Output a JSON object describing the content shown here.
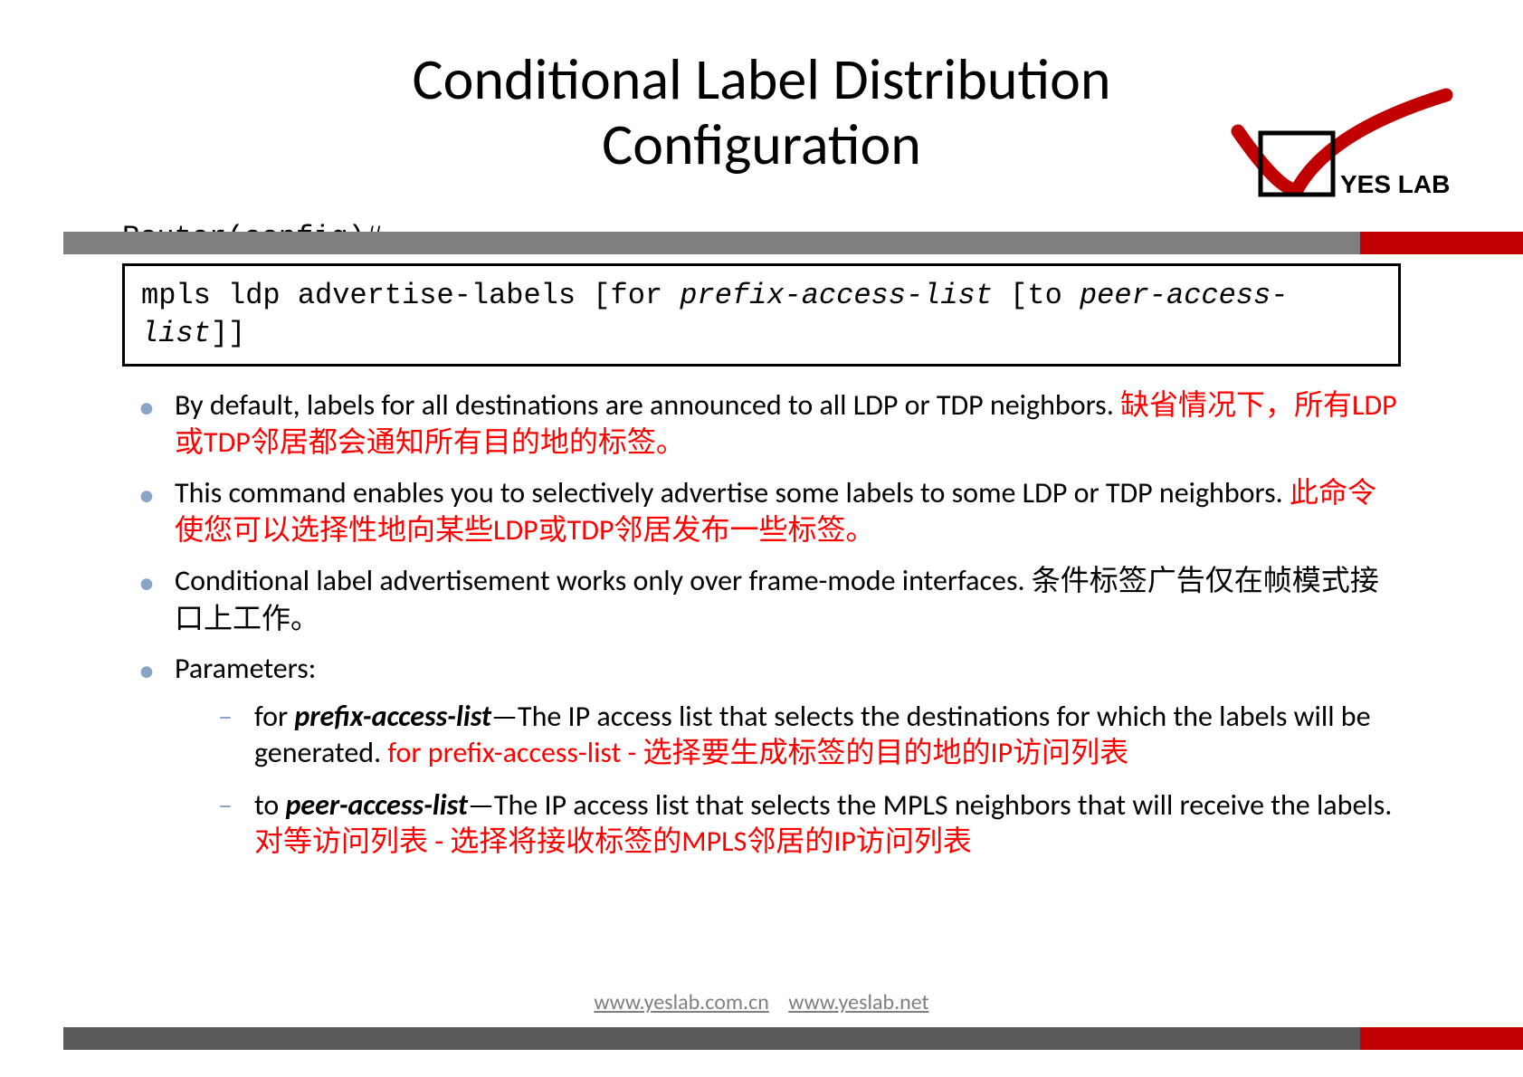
{
  "title": {
    "line1": "Conditional Label Distribution",
    "line2": "Configuration"
  },
  "logo": {
    "text": "YES LAB"
  },
  "prompt": "Router(config)#",
  "command": {
    "prefix": "mpls ldp advertise-labels [for ",
    "arg1": "prefix-access-list",
    "mid": " [to ",
    "arg2": "peer-access-list",
    "suffix": "]]"
  },
  "bullets": {
    "b1_en": "By default, labels for all destinations are announced to all LDP or TDP neighbors. ",
    "b1_zh": "缺省情况下，所有LDP或TDP邻居都会通知所有目的地的标签。",
    "b2_en": "This command enables you to selectively advertise some labels to some LDP or TDP neighbors. ",
    "b2_zh": "此命令使您可以选择性地向某些LDP或TDP邻居发布一些标签。",
    "b3_en": "Conditional label advertisement works only over frame-mode interfaces. ",
    "b3_zh": "条件标签广告仅在帧模式接口上工作。",
    "b4": "Parameters:"
  },
  "params": {
    "p1_for": "for ",
    "p1_name": "prefix-access-list",
    "p1_desc": "—The IP access list that selects the destinations for which the labels will be generated.   ",
    "p1_zh": "for prefix-access-list - 选择要生成标签的目的地的IP访问列表",
    "p2_to": "to ",
    "p2_name": "peer-access-list",
    "p2_desc": "—The IP access list that selects the MPLS neighbors that will receive the labels. ",
    "p2_zh": "对等访问列表 - 选择将接收标签的MPLS邻居的IP访问列表"
  },
  "footer": {
    "link1": "www.yeslab.com.cn",
    "link2": "www.yeslab.net"
  }
}
